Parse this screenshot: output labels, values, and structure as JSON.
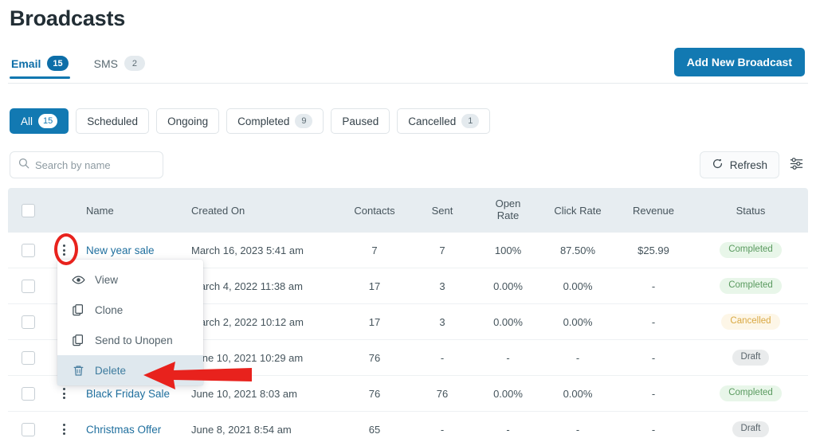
{
  "header": {
    "title": "Broadcasts",
    "add_button": "Add New Broadcast"
  },
  "tabs": [
    {
      "label": "Email",
      "badge": "15",
      "active": true
    },
    {
      "label": "SMS",
      "badge": "2",
      "active": false
    }
  ],
  "filters": [
    {
      "label": "All",
      "badge": "15",
      "active": true
    },
    {
      "label": "Scheduled",
      "badge": "",
      "active": false
    },
    {
      "label": "Ongoing",
      "badge": "",
      "active": false
    },
    {
      "label": "Completed",
      "badge": "9",
      "active": false
    },
    {
      "label": "Paused",
      "badge": "",
      "active": false
    },
    {
      "label": "Cancelled",
      "badge": "1",
      "active": false
    }
  ],
  "toolbar": {
    "search_placeholder": "Search by name",
    "search_value": "",
    "refresh_label": "Refresh",
    "search_icon": "search-icon",
    "refresh_icon": "refresh-icon",
    "settings_icon": "sliders-icon"
  },
  "table": {
    "columns": {
      "name": "Name",
      "created_on": "Created On",
      "contacts": "Contacts",
      "sent": "Sent",
      "open_rate_l1": "Open",
      "open_rate_l2": "Rate",
      "click_rate": "Click Rate",
      "revenue": "Revenue",
      "status": "Status"
    },
    "rows": [
      {
        "name": "New year sale",
        "created_on": "March 16, 2023 5:41 am",
        "contacts": "7",
        "sent": "7",
        "open_rate": "100%",
        "click_rate": "87.50%",
        "revenue": "$25.99",
        "status": "Completed",
        "status_kind": "completed"
      },
      {
        "name": "",
        "created_on": "March 4, 2022 11:38 am",
        "contacts": "17",
        "sent": "3",
        "open_rate": "0.00%",
        "click_rate": "0.00%",
        "revenue": "-",
        "status": "Completed",
        "status_kind": "completed"
      },
      {
        "name": "",
        "created_on": "March 2, 2022 10:12 am",
        "contacts": "17",
        "sent": "3",
        "open_rate": "0.00%",
        "click_rate": "0.00%",
        "revenue": "-",
        "status": "Cancelled",
        "status_kind": "cancelled"
      },
      {
        "name": "",
        "created_on": "June 10, 2021 10:29 am",
        "contacts": "76",
        "sent": "-",
        "open_rate": "-",
        "click_rate": "-",
        "revenue": "-",
        "status": "Draft",
        "status_kind": "draft"
      },
      {
        "name": "Black Friday Sale",
        "created_on": "June 10, 2021 8:03 am",
        "contacts": "76",
        "sent": "76",
        "open_rate": "0.00%",
        "click_rate": "0.00%",
        "revenue": "-",
        "status": "Completed",
        "status_kind": "completed"
      },
      {
        "name": "Christmas Offer",
        "created_on": "June 8, 2021 8:54 am",
        "contacts": "65",
        "sent": "-",
        "open_rate": "-",
        "click_rate": "-",
        "revenue": "-",
        "status": "Draft",
        "status_kind": "draft"
      }
    ]
  },
  "dropdown": {
    "items": [
      {
        "label": "View",
        "icon": "eye-icon",
        "highlight": false
      },
      {
        "label": "Clone",
        "icon": "copy-icon",
        "highlight": false
      },
      {
        "label": "Send to Unopen",
        "icon": "copy-icon",
        "highlight": false
      },
      {
        "label": "Delete",
        "icon": "trash-icon",
        "highlight": true
      }
    ]
  },
  "annotations": {
    "ellipse_color": "#e8221d",
    "arrow_color": "#e8221d"
  },
  "colors": {
    "accent": "#1279b2",
    "link": "#1f6f9e",
    "header_bg": "#e7edf1",
    "completed": "#5a9a5f",
    "cancelled": "#d9a843",
    "draft": "#59646b"
  }
}
